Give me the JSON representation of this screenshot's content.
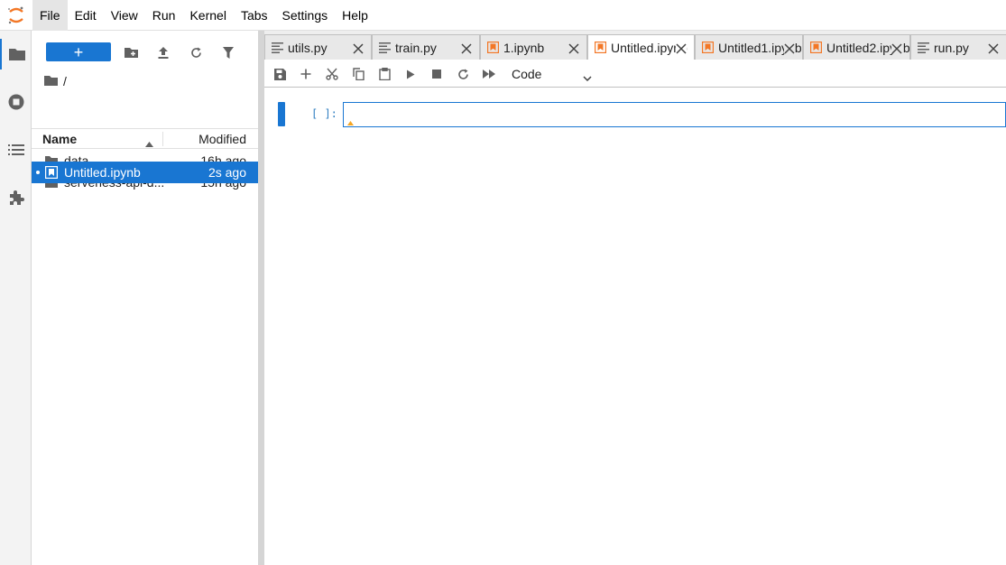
{
  "menubar": {
    "items": [
      "File",
      "Edit",
      "View",
      "Run",
      "Kernel",
      "Tabs",
      "Settings",
      "Help"
    ],
    "active": "File"
  },
  "activity_bar": {
    "icons": [
      "folder-icon",
      "running-icon",
      "toc-icon",
      "extension-icon"
    ]
  },
  "file_browser": {
    "new_button_label": "+",
    "breadcrumb": "/",
    "columns": {
      "name": "Name",
      "modified": "Modified"
    },
    "rows": [
      {
        "name": "data",
        "modified": "16h ago",
        "type": "folder",
        "selected": false
      },
      {
        "name": "serverless-api-d...",
        "modified": "15h ago",
        "type": "folder",
        "selected": false
      },
      {
        "name": "Untitled.ipynb",
        "modified": "2s ago",
        "type": "notebook",
        "selected": true
      }
    ]
  },
  "tabs": [
    {
      "label": "utils.py",
      "type": "text"
    },
    {
      "label": "train.py",
      "type": "text"
    },
    {
      "label": "1.ipynb",
      "type": "notebook"
    },
    {
      "label": "Untitled.ipynb",
      "type": "notebook"
    },
    {
      "label": "Untitled1.ipynb",
      "type": "notebook"
    },
    {
      "label": "Untitled2.ipynb",
      "type": "notebook"
    },
    {
      "label": "run.py",
      "type": "text"
    }
  ],
  "notebook_toolbar": {
    "cell_type": "Code"
  },
  "cell": {
    "prompt": "[ ]:"
  },
  "colors": {
    "accent": "#1976d2",
    "notebook_icon": "#f37726",
    "prompt": "#307fc1"
  }
}
